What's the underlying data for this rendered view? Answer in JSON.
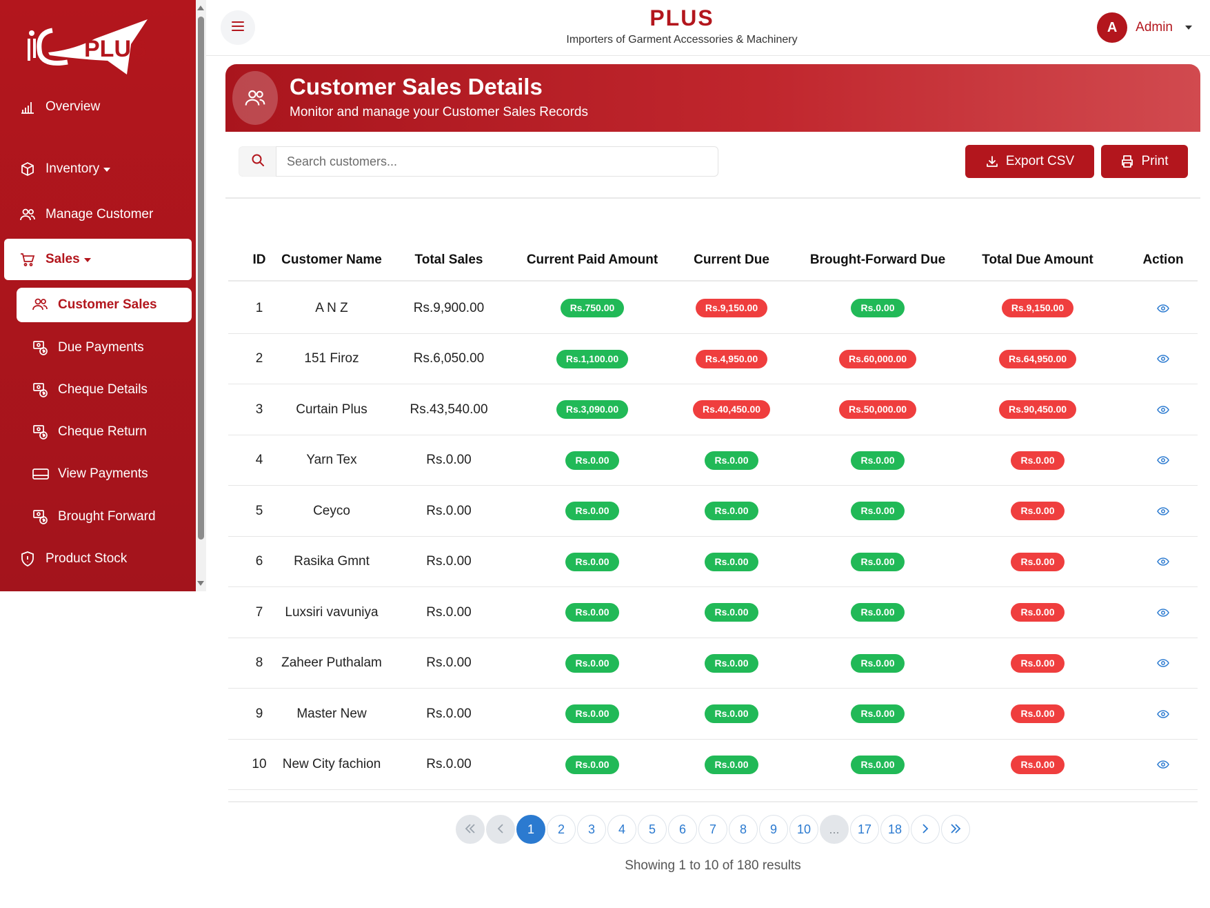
{
  "logo_text": "PLUS",
  "header": {
    "title": "PLUS",
    "subtitle": "Importers of Garment Accessories & Machinery",
    "user_initial": "A",
    "user_name": "Admin"
  },
  "sidebar": {
    "items": [
      {
        "label": "Overview",
        "icon": "bar-chart-icon"
      },
      {
        "label": "Inventory",
        "icon": "box-icon"
      },
      {
        "label": "Manage Customer",
        "icon": "users-icon"
      },
      {
        "label": "Sales",
        "icon": "cart-icon"
      },
      {
        "label": "Product Stock",
        "icon": "shield-icon"
      }
    ],
    "sales_sub": [
      {
        "label": "Customer Sales",
        "icon": "users-icon"
      },
      {
        "label": "Due Payments",
        "icon": "money-icon"
      },
      {
        "label": "Cheque Details",
        "icon": "money-icon"
      },
      {
        "label": "Cheque Return",
        "icon": "money-icon"
      },
      {
        "label": "View Payments",
        "icon": "card-icon"
      },
      {
        "label": "Brought Forward",
        "icon": "money-icon"
      }
    ]
  },
  "banner": {
    "title": "Customer Sales Details",
    "subtitle": "Monitor and manage your Customer Sales Records"
  },
  "toolbar": {
    "search_placeholder": "Search customers...",
    "export_label": "Export CSV",
    "print_label": "Print"
  },
  "table": {
    "headers": [
      "ID",
      "Customer Name",
      "Total Sales",
      "Current Paid Amount",
      "Current Due",
      "Brought-Forward Due",
      "Total Due Amount",
      "Action"
    ],
    "rows": [
      {
        "id": "1",
        "name": "A N Z",
        "total": "Rs.9,900.00",
        "paid": "Rs.750.00",
        "due": "Rs.9,150.00",
        "bf": "Rs.0.00",
        "total_due": "Rs.9,150.00",
        "due_status": "red",
        "bf_status": "green"
      },
      {
        "id": "2",
        "name": "151 Firoz",
        "total": "Rs.6,050.00",
        "paid": "Rs.1,100.00",
        "due": "Rs.4,950.00",
        "bf": "Rs.60,000.00",
        "total_due": "Rs.64,950.00",
        "due_status": "red",
        "bf_status": "red"
      },
      {
        "id": "3",
        "name": "Curtain Plus",
        "total": "Rs.43,540.00",
        "paid": "Rs.3,090.00",
        "due": "Rs.40,450.00",
        "bf": "Rs.50,000.00",
        "total_due": "Rs.90,450.00",
        "due_status": "red",
        "bf_status": "red"
      },
      {
        "id": "4",
        "name": "Yarn Tex",
        "total": "Rs.0.00",
        "paid": "Rs.0.00",
        "due": "Rs.0.00",
        "bf": "Rs.0.00",
        "total_due": "Rs.0.00",
        "due_status": "green",
        "bf_status": "green"
      },
      {
        "id": "5",
        "name": "Ceyco",
        "total": "Rs.0.00",
        "paid": "Rs.0.00",
        "due": "Rs.0.00",
        "bf": "Rs.0.00",
        "total_due": "Rs.0.00",
        "due_status": "green",
        "bf_status": "green"
      },
      {
        "id": "6",
        "name": "Rasika Gmnt",
        "total": "Rs.0.00",
        "paid": "Rs.0.00",
        "due": "Rs.0.00",
        "bf": "Rs.0.00",
        "total_due": "Rs.0.00",
        "due_status": "green",
        "bf_status": "green"
      },
      {
        "id": "7",
        "name": "Luxsiri vavuniya",
        "total": "Rs.0.00",
        "paid": "Rs.0.00",
        "due": "Rs.0.00",
        "bf": "Rs.0.00",
        "total_due": "Rs.0.00",
        "due_status": "green",
        "bf_status": "green"
      },
      {
        "id": "8",
        "name": "Zaheer Puthalam",
        "total": "Rs.0.00",
        "paid": "Rs.0.00",
        "due": "Rs.0.00",
        "bf": "Rs.0.00",
        "total_due": "Rs.0.00",
        "due_status": "green",
        "bf_status": "green"
      },
      {
        "id": "9",
        "name": "Master New",
        "total": "Rs.0.00",
        "paid": "Rs.0.00",
        "due": "Rs.0.00",
        "bf": "Rs.0.00",
        "total_due": "Rs.0.00",
        "due_status": "green",
        "bf_status": "green"
      },
      {
        "id": "10",
        "name": "New City fachion",
        "total": "Rs.0.00",
        "paid": "Rs.0.00",
        "due": "Rs.0.00",
        "bf": "Rs.0.00",
        "total_due": "Rs.0.00",
        "due_status": "green",
        "bf_status": "green"
      }
    ]
  },
  "pagination": {
    "pages": [
      "1",
      "2",
      "3",
      "4",
      "5",
      "6",
      "7",
      "8",
      "9",
      "10",
      "...",
      "17",
      "18"
    ],
    "current": "1",
    "results_text": "Showing 1 to 10 of 180 results"
  },
  "colors": {
    "brand": "#b3161d",
    "paid_green": "#21b957",
    "due_red": "#ef3e3e",
    "link_blue": "#2b7ad0"
  }
}
